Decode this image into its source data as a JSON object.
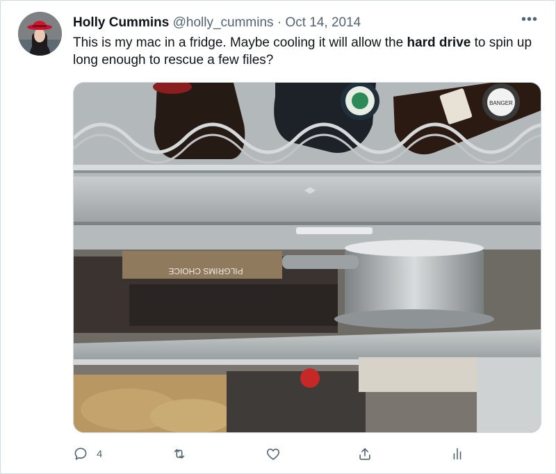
{
  "tweet": {
    "author_name": "Holly Cummins",
    "author_handle": "@holly_cummins",
    "separator": "·",
    "date": "Oct 14, 2014",
    "more_label": "•••",
    "text_before": "This is my mac in a fridge. Maybe cooling it will allow the ",
    "text_bold": "hard drive",
    "text_after": " to spin up long enough to rescue a few files?",
    "media_alt": "Photo of a MacBook on a fridge shelf",
    "bottle_label_text": "BANGER",
    "package_text": "PILGRIMS CHOICE"
  },
  "actions": {
    "reply_count": "4",
    "retweet_count": "",
    "like_count": ""
  },
  "colors": {
    "text_primary": "#0f1419",
    "text_secondary": "#536471",
    "border": "#cfd9de"
  }
}
